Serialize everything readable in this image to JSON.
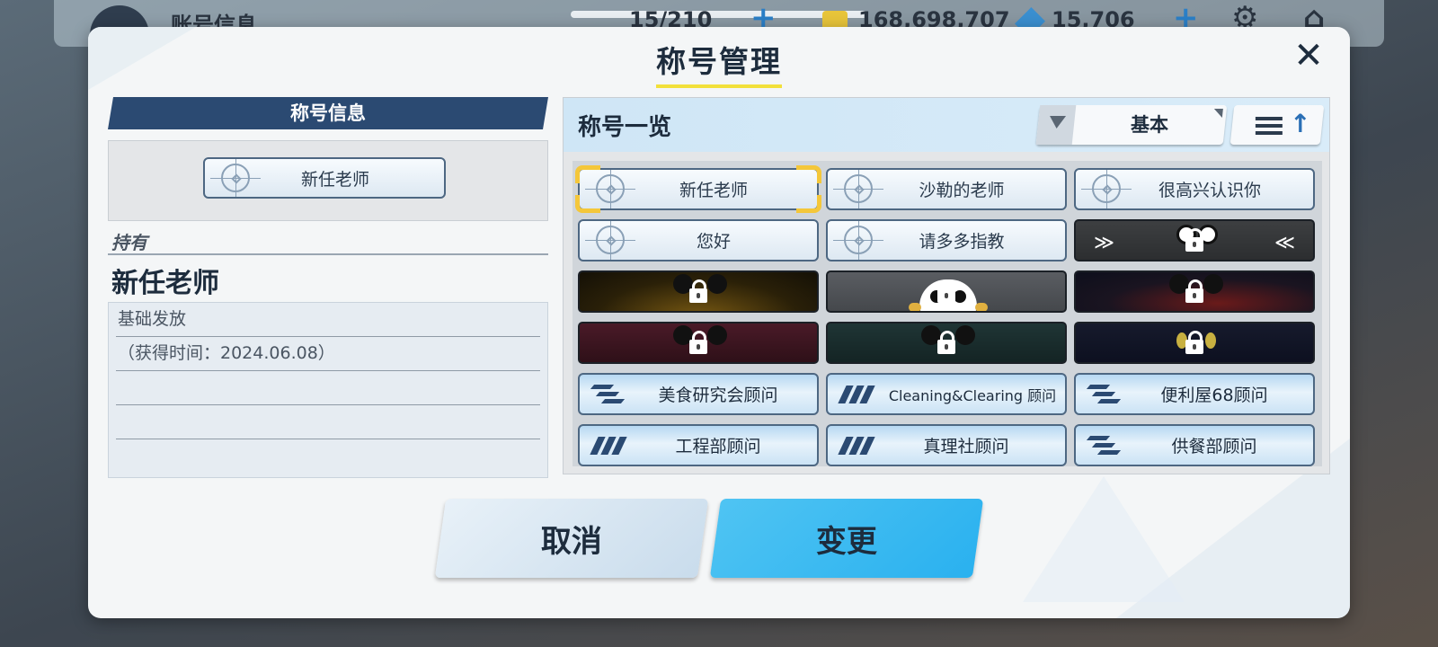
{
  "topbar": {
    "title": "账号信息",
    "stamina": "15/210",
    "credits": "168,698,707",
    "gems": "15,706"
  },
  "dialog": {
    "title": "称号管理",
    "close_icon": "close-icon"
  },
  "left": {
    "section_header": "称号信息",
    "current_title": "新任老师",
    "owned_label": "持有",
    "owned_name": "新任老师",
    "details": [
      "基础发放",
      "（获得时间：2024.06.08）",
      "",
      "",
      ""
    ]
  },
  "right": {
    "header": "称号一览",
    "filter_label": "基本",
    "titles": [
      {
        "kind": "basic",
        "label": "新任老师",
        "selected": true
      },
      {
        "kind": "basic",
        "label": "沙勒的老师"
      },
      {
        "kind": "basic",
        "label": "很高兴认识你"
      },
      {
        "kind": "basic",
        "label": "您好"
      },
      {
        "kind": "basic",
        "label": "请多多指教"
      },
      {
        "kind": "locked",
        "theme": "gray-wings"
      },
      {
        "kind": "locked",
        "theme": "dark-gold"
      },
      {
        "kind": "locked",
        "theme": "gray-skull"
      },
      {
        "kind": "locked",
        "theme": "navy-red"
      },
      {
        "kind": "locked",
        "theme": "maroon"
      },
      {
        "kind": "locked",
        "theme": "teal"
      },
      {
        "kind": "locked",
        "theme": "navy-cat"
      },
      {
        "kind": "club",
        "icon": "arrow-emblem-icon",
        "label": "美食研究会顾问"
      },
      {
        "kind": "club",
        "icon": "m-emblem-icon",
        "label": "Cleaning&Clearing 顾问"
      },
      {
        "kind": "club",
        "icon": "arrow-emblem-icon",
        "label": "便利屋68顾问"
      },
      {
        "kind": "club",
        "icon": "m-emblem-icon",
        "label": "工程部顾问"
      },
      {
        "kind": "club",
        "icon": "m-emblem-icon",
        "label": "真理社顾问"
      },
      {
        "kind": "club",
        "icon": "arrow-emblem-icon",
        "label": "供餐部顾问"
      }
    ]
  },
  "buttons": {
    "cancel": "取消",
    "confirm": "变更"
  }
}
